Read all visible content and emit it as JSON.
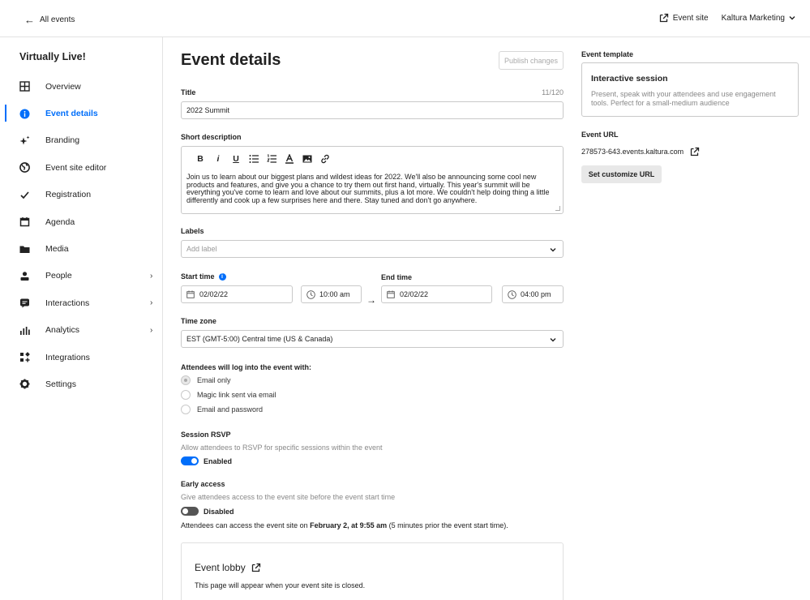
{
  "topbar": {
    "back_label": "All events",
    "event_site_label": "Event site",
    "account_label": "Kaltura Marketing"
  },
  "sidebar": {
    "title": "Virtually Live!",
    "items": [
      {
        "label": "Overview",
        "icon": "grid-icon",
        "active": false,
        "chevron": false
      },
      {
        "label": "Event details",
        "icon": "info-icon",
        "active": true,
        "chevron": false
      },
      {
        "label": "Branding",
        "icon": "sparkle-icon",
        "active": false,
        "chevron": false
      },
      {
        "label": "Event site editor",
        "icon": "globe-icon",
        "active": false,
        "chevron": false
      },
      {
        "label": "Registration",
        "icon": "check-icon",
        "active": false,
        "chevron": false
      },
      {
        "label": "Agenda",
        "icon": "calendar-icon",
        "active": false,
        "chevron": false
      },
      {
        "label": "Media",
        "icon": "folder-icon",
        "active": false,
        "chevron": false
      },
      {
        "label": "People",
        "icon": "person-icon",
        "active": false,
        "chevron": true
      },
      {
        "label": "Interactions",
        "icon": "chat-icon",
        "active": false,
        "chevron": true
      },
      {
        "label": "Analytics",
        "icon": "bar-chart-icon",
        "active": false,
        "chevron": true
      },
      {
        "label": "Integrations",
        "icon": "integrations-icon",
        "active": false,
        "chevron": false
      },
      {
        "label": "Settings",
        "icon": "gear-icon",
        "active": false,
        "chevron": false
      }
    ]
  },
  "form": {
    "page_title": "Event details",
    "publish_label": "Publish changes",
    "title_label": "Title",
    "title_counter": "11/120",
    "title_value": "2022 Summit",
    "short_desc_label": "Short description",
    "toolbar": [
      "B",
      "i",
      "U"
    ],
    "short_desc_value": "Join us to learn about our biggest plans and wildest ideas for 2022. We'll also be announcing some cool new products and features, and give you a chance to try them out first hand, virtually. This year's summit will be everything you've come to learn and love about our summits, plus a lot more. We couldn't help doing thing a little differently and cook up a few surprises here and there. Stay tuned and don't go anywhere.",
    "labels_label": "Labels",
    "labels_placeholder": "Add label",
    "start_time_label": "Start time",
    "end_time_label": "End time",
    "start_date": "02/02/22",
    "start_time": "10:00 am",
    "end_date": "02/02/22",
    "end_time": "04:00 pm",
    "timezone_label": "Time zone",
    "timezone_value": "EST (GMT-5:00) Central time (US & Canada)",
    "login_label": "Attendees will log into the event with:",
    "login_options": [
      "Email only",
      "Magic link sent via email",
      "Email and password"
    ],
    "login_selected": 0,
    "rsvp_label": "Session RSVP",
    "rsvp_hint": "Allow attendees to RSVP for specific sessions within the event",
    "rsvp_state": "Enabled",
    "early_label": "Early access",
    "early_hint": "Give attendees access to the event site before the event start time",
    "early_state": "Disabled",
    "early_note_prefix": "Attendees can access the event site on ",
    "early_note_bold": "February 2, at 9:55 am",
    "early_note_suffix": " (5 minutes prior the event start time).",
    "lobby_title": "Event lobby",
    "lobby_desc": "This page will appear when your event site is closed."
  },
  "right": {
    "template_label": "Event template",
    "template_title": "Interactive session",
    "template_desc": "Present, speak with your attendees and use engagement tools. Perfect for a small-medium audience",
    "url_label": "Event URL",
    "url_value": "278573-643.events.kaltura.com",
    "set_url_label": "Set customize URL"
  },
  "colors": {
    "accent": "#006efa",
    "border": "#c9c9c9",
    "muted": "#888888"
  }
}
